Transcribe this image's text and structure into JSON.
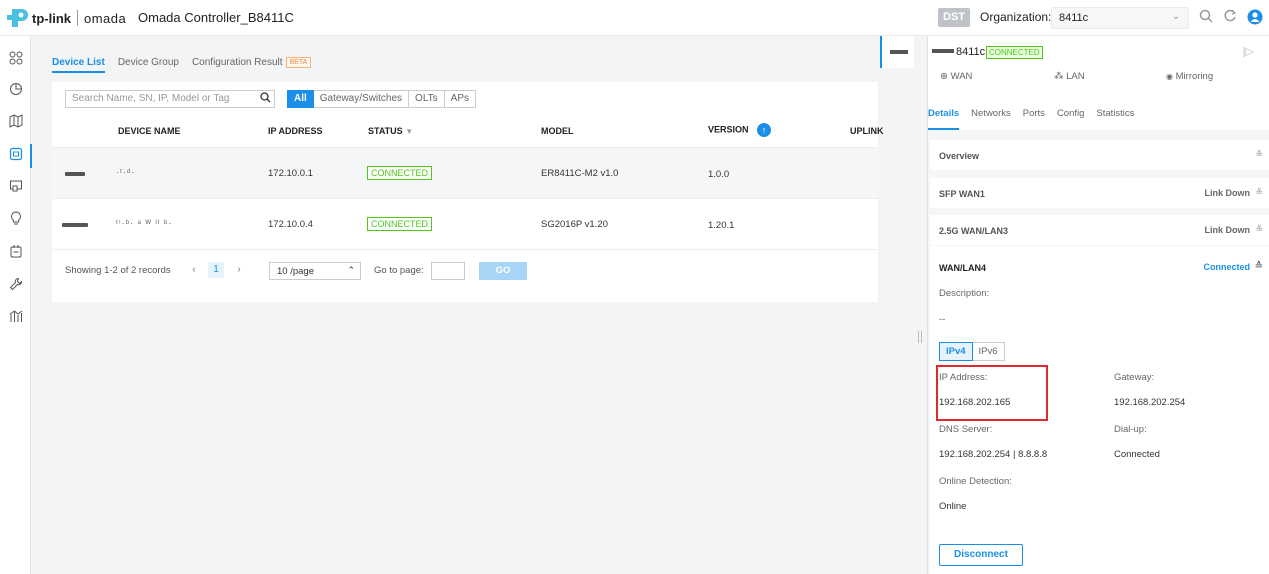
{
  "header": {
    "brand": "tp-link",
    "product": "omada",
    "controller_name": "Omada Controller_B8411C",
    "dst_label": "DST",
    "organization_label": "Organization:",
    "organization_value": "8411c"
  },
  "sidebar": {
    "items": [
      {
        "icon": "dashboard-icon"
      },
      {
        "icon": "statistics-icon"
      },
      {
        "icon": "map-icon"
      },
      {
        "icon": "devices-icon",
        "active": true
      },
      {
        "icon": "clients-icon"
      },
      {
        "icon": "insight-icon"
      },
      {
        "icon": "log-icon"
      },
      {
        "icon": "tools-icon"
      },
      {
        "icon": "reports-icon"
      }
    ]
  },
  "tabs": {
    "device_list": "Device List",
    "device_group": "Device Group",
    "config_result": "Configuration Result",
    "beta": "BETA"
  },
  "toolbar": {
    "search_placeholder": "Search Name, SN, IP, Model or Tag",
    "filters": [
      "All",
      "Gateway/Switches",
      "OLTs",
      "APs"
    ]
  },
  "table": {
    "headers": {
      "device_name": "DEVICE NAME",
      "ip": "IP ADDRESS",
      "status": "STATUS",
      "model": "MODEL",
      "version": "VERSION",
      "uplink": "UPLINK"
    },
    "rows": [
      {
        "name": "·ᵗ·ᵈ·",
        "ip": "172.10.0.1",
        "status": "CONNECTED",
        "model": "ER8411C-M2 v1.0",
        "version": "1.0.0"
      },
      {
        "name": "ᵗⁱ·ᵇ· ᵃ ᵂ ᴵᴵ ᵇ·",
        "ip": "172.10.0.4",
        "status": "CONNECTED",
        "model": "SG2016P v1.20",
        "version": "1.20.1"
      }
    ]
  },
  "pagination": {
    "showing": "Showing 1-2 of 2 records",
    "prev": "‹",
    "current_page": "1",
    "next": "›",
    "page_size": "10 /page",
    "goto_label": "Go to page:",
    "go_button": "GO"
  },
  "panel": {
    "device_name": "8411c",
    "status_badge": "CONNECTED",
    "quick_links": [
      "WAN",
      "LAN",
      "Mirroring"
    ],
    "tabs": [
      "Details",
      "Networks",
      "Ports",
      "Config",
      "Statistics"
    ],
    "sections": [
      {
        "title": "Overview",
        "status": ""
      },
      {
        "title": "SFP WAN1",
        "status": "Link Down"
      },
      {
        "title": "2.5G WAN/LAN3",
        "status": "Link Down"
      }
    ],
    "wan4": {
      "title": "WAN/LAN4",
      "status": "Connected",
      "description_label": "Description:",
      "description_value": "--",
      "ip_tabs": [
        "IPv4",
        "IPv6"
      ],
      "ip_address_label": "IP Address:",
      "ip_address_value": "192.168.202.165",
      "gateway_label": "Gateway:",
      "gateway_value": "192.168.202.254",
      "dns_label": "DNS Server:",
      "dns_value": "192.168.202.254 | 8.8.8.8",
      "dialup_label": "Dial-up:",
      "dialup_value": "Connected",
      "online_detection_label": "Online Detection:",
      "online_detection_value": "Online",
      "disconnect_button": "Disconnect"
    }
  },
  "colors": {
    "accent": "#1b8fe8",
    "connected": "#52c41a",
    "highlight_box": "#e0282e",
    "beta": "#f08c3c"
  }
}
